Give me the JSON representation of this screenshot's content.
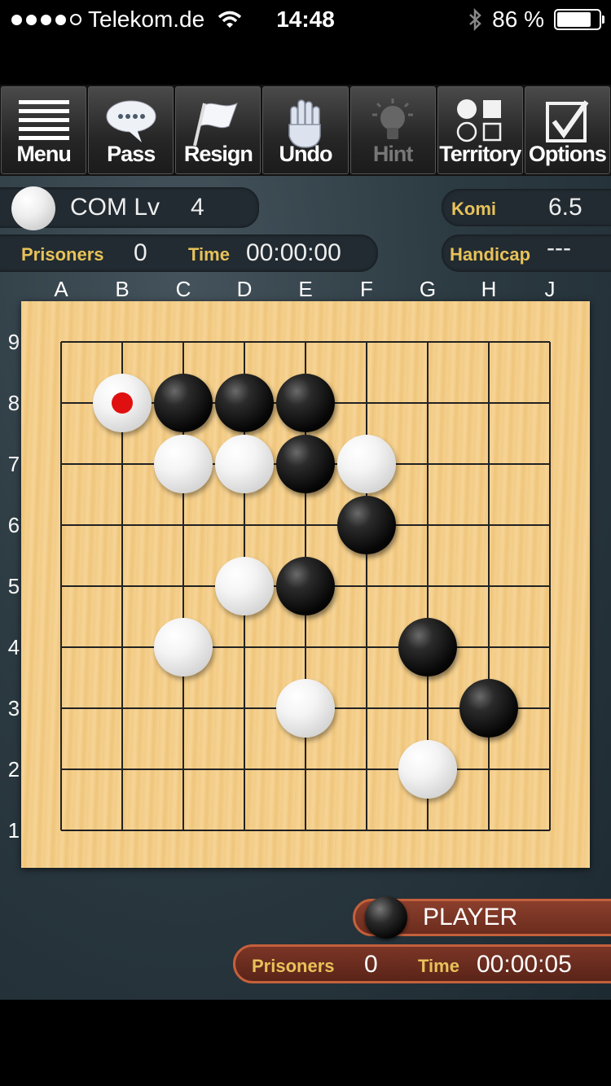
{
  "status_bar": {
    "carrier": "Telekom.de",
    "time": "14:48",
    "battery": "86 %",
    "battery_level": 0.86,
    "signal_bars_filled": 4,
    "signal_bars_total": 5
  },
  "toolbar": [
    {
      "id": "menu",
      "label": "Menu",
      "icon": "menu-icon",
      "enabled": true
    },
    {
      "id": "pass",
      "label": "Pass",
      "icon": "speech-bubble-icon",
      "enabled": true
    },
    {
      "id": "resign",
      "label": "Resign",
      "icon": "flag-icon",
      "enabled": true
    },
    {
      "id": "undo",
      "label": "Undo",
      "icon": "hand-icon",
      "enabled": true
    },
    {
      "id": "hint",
      "label": "Hint",
      "icon": "lightbulb-icon",
      "enabled": false
    },
    {
      "id": "territory",
      "label": "Territory",
      "icon": "shapes-icon",
      "enabled": true
    },
    {
      "id": "options",
      "label": "Options",
      "icon": "checkbox-icon",
      "enabled": true
    }
  ],
  "opponent": {
    "name": "COM Lv",
    "level": "4",
    "stone_color": "white",
    "prisoners_label": "Prisoners",
    "prisoners": "0",
    "time_label": "Time",
    "time": "00:00:00"
  },
  "game_info": {
    "komi_label": "Komi",
    "komi": "6.5",
    "handicap_label": "Handicap",
    "handicap": "---"
  },
  "board": {
    "size": 9,
    "columns": [
      "A",
      "B",
      "C",
      "D",
      "E",
      "F",
      "G",
      "H",
      "J"
    ],
    "rows": [
      "9",
      "8",
      "7",
      "6",
      "5",
      "4",
      "3",
      "2",
      "1"
    ],
    "last_move": "B8",
    "stones": [
      {
        "point": "B8",
        "color": "white"
      },
      {
        "point": "C8",
        "color": "black"
      },
      {
        "point": "D8",
        "color": "black"
      },
      {
        "point": "E8",
        "color": "black"
      },
      {
        "point": "C7",
        "color": "white"
      },
      {
        "point": "D7",
        "color": "white"
      },
      {
        "point": "E7",
        "color": "black"
      },
      {
        "point": "F7",
        "color": "white"
      },
      {
        "point": "F6",
        "color": "black"
      },
      {
        "point": "D5",
        "color": "white"
      },
      {
        "point": "E5",
        "color": "black"
      },
      {
        "point": "C4",
        "color": "white"
      },
      {
        "point": "G4",
        "color": "black"
      },
      {
        "point": "E3",
        "color": "white"
      },
      {
        "point": "H3",
        "color": "black"
      },
      {
        "point": "G2",
        "color": "white"
      }
    ]
  },
  "player": {
    "name": "PLAYER",
    "stone_color": "black",
    "prisoners_label": "Prisoners",
    "prisoners": "0",
    "time_label": "Time",
    "time": "00:00:05"
  },
  "colors": {
    "board_wood": "#f2cb83",
    "accent_gold": "#e8c25a",
    "player_panel": "#7a3524",
    "last_move_marker": "#e01010"
  }
}
